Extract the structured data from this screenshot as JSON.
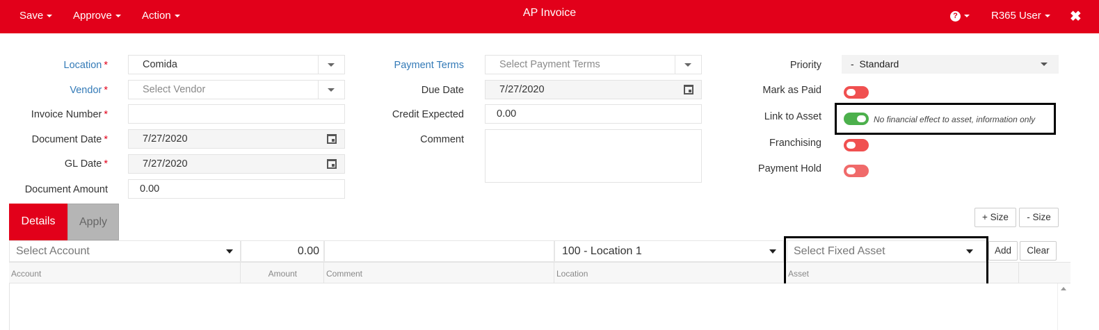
{
  "header": {
    "menus": [
      {
        "label": "Save"
      },
      {
        "label": "Approve"
      },
      {
        "label": "Action"
      }
    ],
    "title": "AP Invoice",
    "help_icon": "question-circle-icon",
    "user_menu": "R365 User",
    "close_icon": "close-icon"
  },
  "form": {
    "location": {
      "label": "Location",
      "value": "Comida"
    },
    "vendor": {
      "label": "Vendor",
      "placeholder": "Select Vendor"
    },
    "invoice_number": {
      "label": "Invoice Number",
      "value": ""
    },
    "document_date": {
      "label": "Document Date",
      "value": "7/27/2020"
    },
    "gl_date": {
      "label": "GL Date",
      "value": "7/27/2020"
    },
    "document_amount": {
      "label": "Document Amount",
      "value": "0.00"
    },
    "payment_terms": {
      "label": "Payment Terms",
      "placeholder": "Select Payment Terms"
    },
    "due_date": {
      "label": "Due Date",
      "value": "7/27/2020"
    },
    "credit_expected": {
      "label": "Credit Expected",
      "value": "0.00"
    },
    "comment": {
      "label": "Comment",
      "value": ""
    },
    "required_marker": "*",
    "priority": {
      "label": "Priority",
      "value": "-  Standard"
    },
    "mark_as_paid": {
      "label": "Mark as Paid",
      "on": false
    },
    "link_to_asset": {
      "label": "Link to Asset",
      "on": true,
      "hint": "No financial effect to asset, information only"
    },
    "franchising": {
      "label": "Franchising",
      "on": false
    },
    "payment_hold": {
      "label": "Payment Hold",
      "on": false
    }
  },
  "tabs": [
    {
      "label": "Details",
      "active": true
    },
    {
      "label": "Apply",
      "active": false
    }
  ],
  "size_buttons": {
    "increase": "+ Size",
    "decrease": "- Size"
  },
  "entry_row": {
    "account_placeholder": "Select Account",
    "amount": "0.00",
    "comment": "",
    "location": "100 - Location 1",
    "fixed_asset_placeholder": "Select Fixed Asset",
    "add_label": "Add",
    "clear_label": "Clear"
  },
  "grid": {
    "columns": [
      "Account",
      "Amount",
      "Comment",
      "Location",
      "Asset"
    ],
    "rows": []
  },
  "colors": {
    "brand": "#e2001a",
    "toggle_on": "#4cb04c",
    "toggle_off": "#f05050",
    "link": "#337ab7"
  }
}
